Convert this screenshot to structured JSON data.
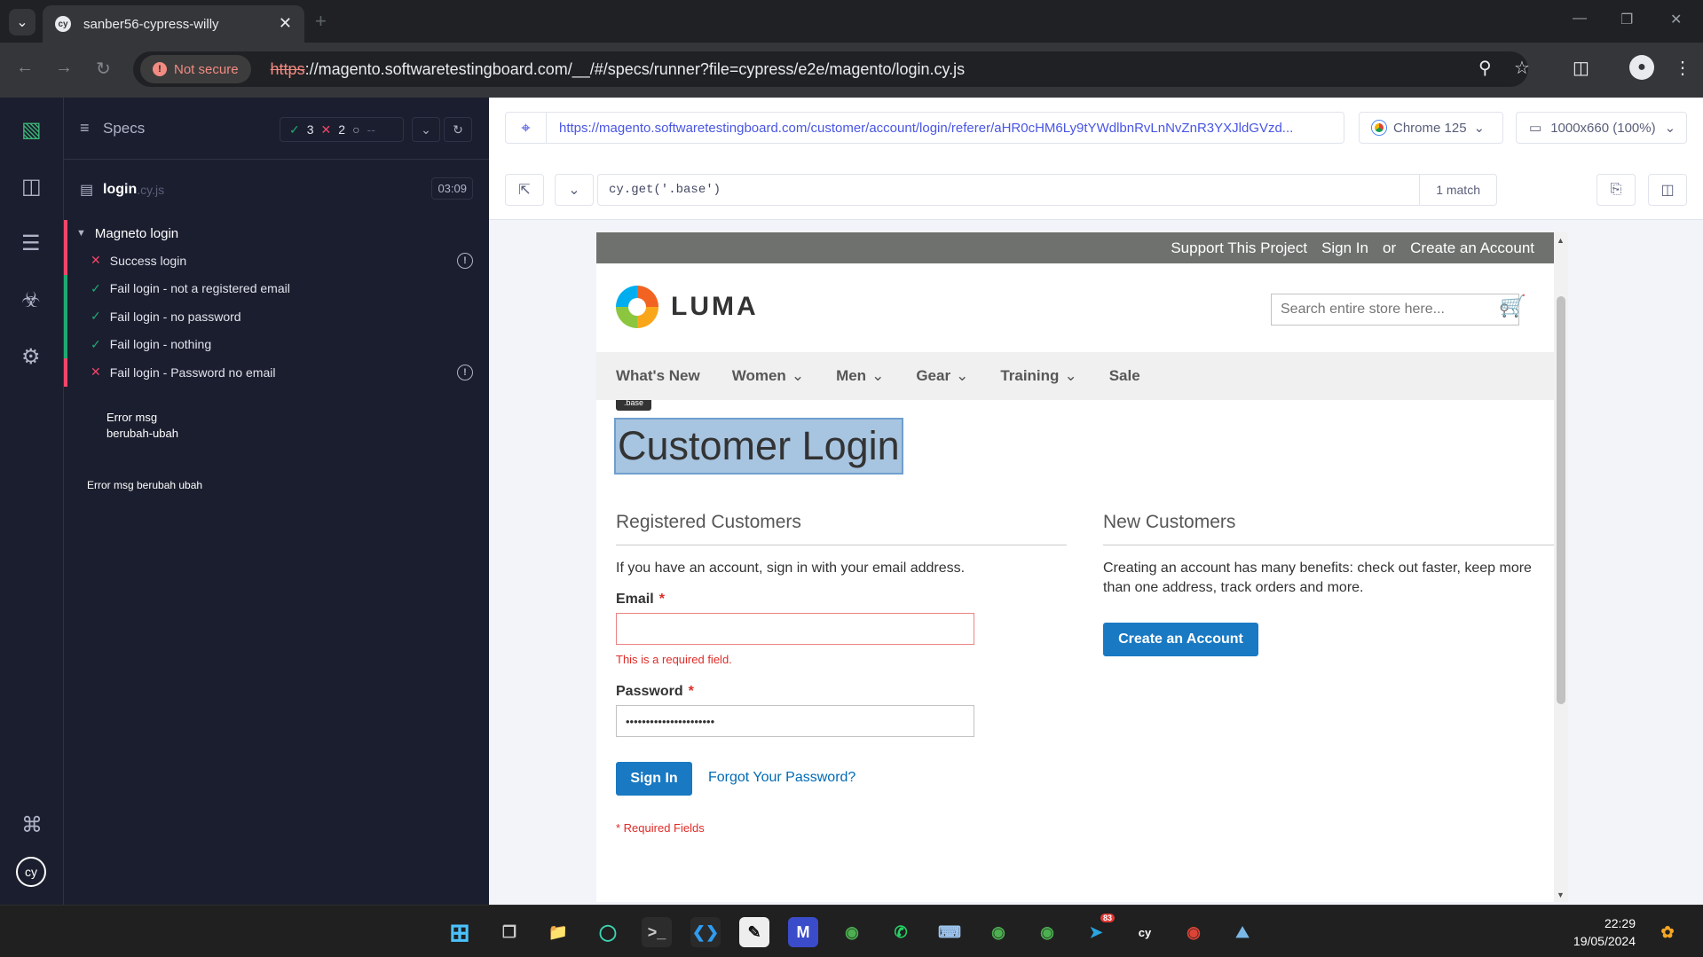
{
  "browser": {
    "tab_title": "sanber56-cypress-willy",
    "not_secure": "Not secure",
    "url_scheme": "https",
    "url_rest": "://magento.softwaretestingboard.com/__/#/specs/runner?file=cypress/e2e/magento/login.cy.js"
  },
  "specs_panel": {
    "title": "Specs",
    "passed": "3",
    "failed": "2",
    "pending": "--",
    "file_name": "login",
    "file_ext": ".cy.js",
    "duration": "03:09",
    "suite": "Magneto login",
    "tests": [
      {
        "label": "Success login",
        "state": "fail"
      },
      {
        "label": "Fail login - not a registered email",
        "state": "pass"
      },
      {
        "label": "Fail login - no password",
        "state": "pass"
      },
      {
        "label": "Fail login - nothing",
        "state": "pass"
      },
      {
        "label": "Fail login - Password no email",
        "state": "fail"
      }
    ],
    "log_msg_1a": "Error msg",
    "log_msg_1b": "berubah-ubah",
    "log_msg_2": "Error msg berubah ubah"
  },
  "runner": {
    "aut_url": "https://magento.softwaretestingboard.com/customer/account/login/referer/aHR0cHM6Ly9tYWdlbnRvLnNvZnR3YXJldGVzd...",
    "browser": "Chrome 125",
    "viewport": "1000x660 (100%)",
    "selector": "cy.get('.base')",
    "matches": "1 match"
  },
  "aut": {
    "panel_links": [
      "Support This Project",
      "Sign In",
      "or",
      "Create an Account"
    ],
    "logo_text": "LUMA",
    "search_placeholder": "Search entire store here...",
    "nav": [
      "What's New",
      "Women",
      "Men",
      "Gear",
      "Training",
      "Sale"
    ],
    "tooltip": ".base",
    "page_title": "Customer Login",
    "registered_title": "Registered Customers",
    "registered_intro": "If you have an account, sign in with your email address.",
    "email_label": "Email",
    "email_value": "",
    "email_error": "This is a required field.",
    "password_label": "Password",
    "password_value": "••••••••••••••••••••••",
    "sign_in_label": "Sign In",
    "forgot_label": "Forgot Your Password?",
    "required_note": "* Required Fields",
    "new_title": "New Customers",
    "new_text": "Creating an account has many benefits: check out faster, keep more than one address, track orders and more.",
    "create_account_label": "Create an Account",
    "required_star": "*"
  },
  "taskbar": {
    "time": "22:29",
    "date": "19/05/2024",
    "telegram_badge": "83"
  },
  "colors": {
    "cypress_bg": "#1b1e2e",
    "pass": "#1fa971",
    "fail": "#f2466b",
    "luma_blue": "#1979c3"
  }
}
